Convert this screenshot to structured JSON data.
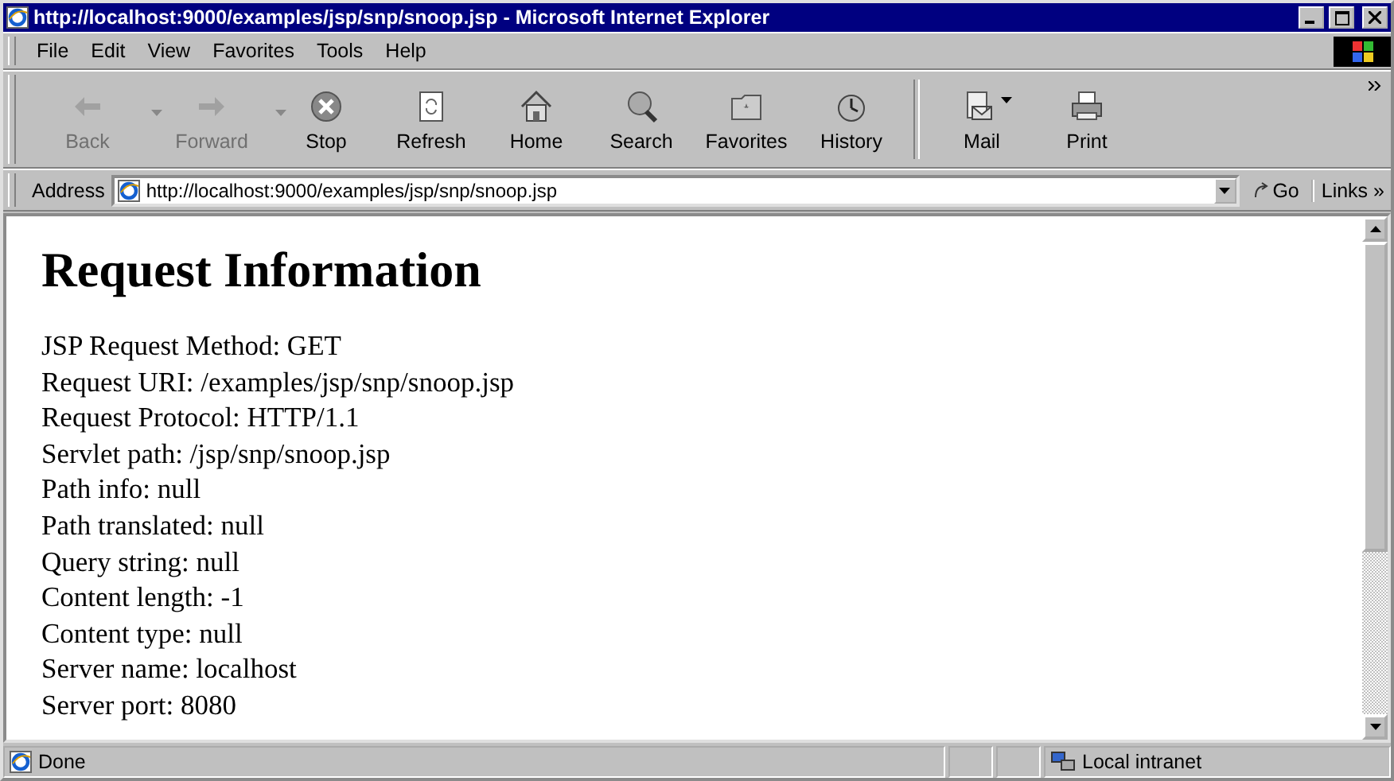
{
  "window": {
    "title": "http://localhost:9000/examples/jsp/snp/snoop.jsp - Microsoft Internet Explorer"
  },
  "menu": [
    "File",
    "Edit",
    "View",
    "Favorites",
    "Tools",
    "Help"
  ],
  "toolbar": [
    {
      "label": "Back",
      "kind": "back",
      "disabled": true,
      "dropdown": true
    },
    {
      "label": "Forward",
      "kind": "forward",
      "disabled": true,
      "dropdown": true
    },
    {
      "label": "Stop",
      "kind": "stop",
      "disabled": false,
      "dropdown": false
    },
    {
      "label": "Refresh",
      "kind": "refresh",
      "disabled": false,
      "dropdown": false
    },
    {
      "label": "Home",
      "kind": "home",
      "disabled": false,
      "dropdown": false
    },
    {
      "label": "Search",
      "kind": "search",
      "disabled": false,
      "dropdown": false
    },
    {
      "label": "Favorites",
      "kind": "favorites",
      "disabled": false,
      "dropdown": false
    },
    {
      "label": "History",
      "kind": "history",
      "disabled": false,
      "dropdown": false
    },
    {
      "label": "Mail",
      "kind": "mail",
      "disabled": false,
      "dropdown": true
    },
    {
      "label": "Print",
      "kind": "print",
      "disabled": false,
      "dropdown": false
    }
  ],
  "address_bar": {
    "label": "Address",
    "value": "http://localhost:9000/examples/jsp/snp/snoop.jsp",
    "go": "Go",
    "links": "Links",
    "links_more": "»"
  },
  "page": {
    "heading": "Request Information",
    "lines": [
      "JSP Request Method: GET",
      "Request URI: /examples/jsp/snp/snoop.jsp",
      "Request Protocol: HTTP/1.1",
      "Servlet path: /jsp/snp/snoop.jsp",
      "Path info: null",
      "Path translated: null",
      "Query string: null",
      "Content length: -1",
      "Content type: null",
      "Server name: localhost",
      "Server port: 8080"
    ]
  },
  "status_bar": {
    "text": "Done",
    "zone": "Local intranet"
  }
}
